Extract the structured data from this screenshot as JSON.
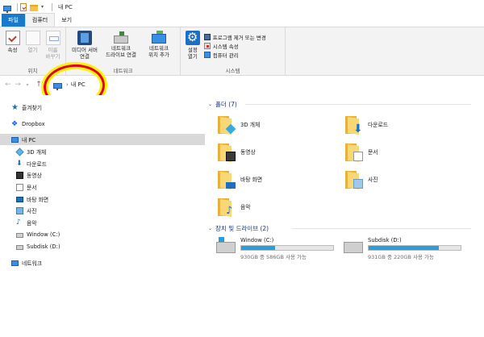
{
  "titlebar": {
    "title": "내 PC"
  },
  "tabs": {
    "file": "파일",
    "computer": "컴퓨터",
    "view": "보기"
  },
  "ribbon": {
    "location": {
      "label": "위치",
      "properties": "속성",
      "open": "열기",
      "rename": "이름\n바꾸기"
    },
    "network": {
      "label": "네트워크",
      "media": "미디어 서버\n연결",
      "map_drive": "네트워크\n드라이브 연결",
      "add_location": "네트워크\n위치 추가"
    },
    "system": {
      "label": "시스템",
      "settings": "설정\n열기",
      "uninstall": "프로그램 제거 또는 변경",
      "sys_props": "시스템 속성",
      "manage": "컴퓨터 관리"
    }
  },
  "address": {
    "crumb": "내 PC"
  },
  "nav": {
    "quick": "즐겨찾기",
    "dropbox": "Dropbox",
    "mypc": "내 PC",
    "objects3d": "3D 개체",
    "downloads": "다운로드",
    "videos": "동영상",
    "documents": "문서",
    "desktop": "바탕 화면",
    "pictures": "사진",
    "music": "음악",
    "windows": "Window (C:)",
    "subdisk": "Subdisk (D:)",
    "network": "네트워크"
  },
  "content": {
    "folders_header": "폴더 (7)",
    "folders": [
      "3D 개체",
      "다운로드",
      "동영상",
      "문서",
      "바탕 화면",
      "사진",
      "음악"
    ],
    "drives_header": "장치 및 드라이브 (2)",
    "drives": [
      {
        "name": "Window (C:)",
        "free": "930GB 중 586GB 사용 가능",
        "used_fraction": 0.37
      },
      {
        "name": "Subdisk (D:)",
        "free": "931GB 중 220GB 사용 가능",
        "used_fraction": 0.76
      }
    ]
  },
  "colors": {
    "accent": "#1979ca",
    "drive_bar": "#26a0da",
    "annotation_red": "#e5001f",
    "annotation_yellow": "#fff200"
  }
}
